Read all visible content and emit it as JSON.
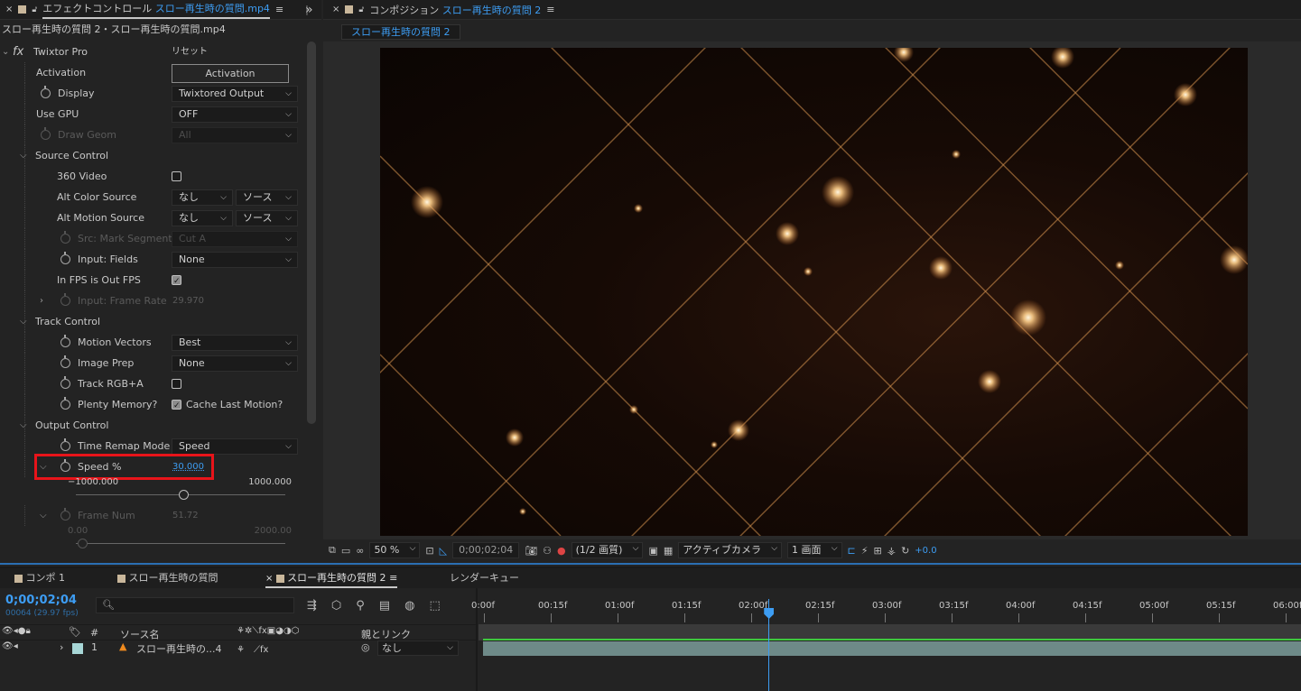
{
  "effect_controls": {
    "tab_title": "エフェクトコントロール",
    "tab_file": "スロー再生時の質問.mp4",
    "subtitle": "スロー再生時の質問 2・スロー再生時の質問.mp4",
    "effect_name": "Twixtor Pro",
    "fx_glyph": "fx",
    "reset_label": "リセット",
    "rows": [
      {
        "label": "Activation",
        "button": "Activation"
      },
      {
        "label": "Display",
        "value": "Twixtored Output"
      },
      {
        "label": "Use GPU",
        "value": "OFF"
      },
      {
        "label": "Draw Geom",
        "value": "All"
      },
      {
        "label": "Source Control"
      },
      {
        "label": "360 Video"
      },
      {
        "label": "Alt Color Source",
        "value": "なし",
        "value2": "ソース"
      },
      {
        "label": "Alt Motion Source",
        "value": "なし",
        "value2": "ソース"
      },
      {
        "label": "Src: Mark Segment",
        "value": "Cut A"
      },
      {
        "label": "Input: Fields",
        "value": "None"
      },
      {
        "label": "In FPS is Out FPS"
      },
      {
        "label": "Input: Frame Rate",
        "value": "29.970"
      },
      {
        "label": "Track Control"
      },
      {
        "label": "Motion Vectors",
        "value": "Best"
      },
      {
        "label": "Image Prep",
        "value": "None"
      },
      {
        "label": "Track RGB+A"
      },
      {
        "label": "Plenty Memory?",
        "value": "Cache Last Motion?"
      },
      {
        "label": "Output Control"
      },
      {
        "label": "Time Remap Mode",
        "value": "Speed"
      },
      {
        "label": "Speed %",
        "value": "30.000"
      },
      {
        "label": "Frame Num",
        "value": "51.72"
      }
    ],
    "speed_slider": {
      "min": "−1000.000",
      "max": "1000.000",
      "position": 0.515
    },
    "frame_slider": {
      "min": "0.00",
      "max": "2000.00",
      "position": 0.03
    }
  },
  "composition": {
    "tab_title": "コンポジション",
    "tab_name": "スロー再生時の質問 2",
    "breadcrumb": "スロー再生時の質問 2",
    "toolbar": {
      "zoom": "50 %",
      "timecode": "0;00;02;04",
      "resolution": "(1/2 画質)",
      "camera": "アクティブカメラ",
      "views": "1 画面",
      "exposure": "+0.0"
    }
  },
  "timeline": {
    "tabs": [
      "コンポ 1",
      "スロー再生時の質問",
      "スロー再生時の質問 2",
      "レンダーキュー"
    ],
    "active_tab": 2,
    "timecode": "0;00;02;04",
    "frames": "00064 (29.97 fps)",
    "search_placeholder": "",
    "columns": {
      "num": "#",
      "source": "ソース名",
      "parent": "親とリンク"
    },
    "layer": {
      "num": "1",
      "name": "スロー再生時の...4",
      "parent": "なし"
    },
    "ruler": [
      "0:00f",
      "00:15f",
      "01:00f",
      "01:15f",
      "02:00f",
      "02:15f",
      "03:00f",
      "03:15f",
      "04:00f",
      "04:15f",
      "05:00f",
      "05:15f",
      "06:00f"
    ],
    "playhead": 2.13
  },
  "colors": {
    "accent": "#3d9df3",
    "highlight": "#e8141a",
    "layer_bar": "#6e8a88"
  }
}
